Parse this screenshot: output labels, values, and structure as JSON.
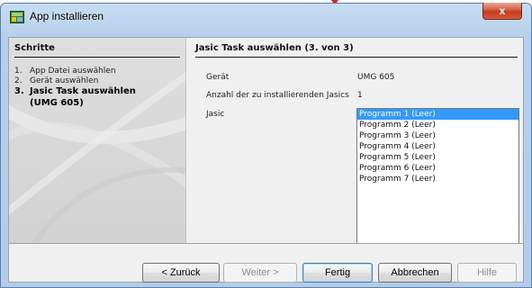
{
  "window": {
    "title": "App installieren",
    "close_label": "x"
  },
  "steps": {
    "title": "Schritte",
    "items": [
      {
        "num": "1.",
        "label": "App Datei auswählen"
      },
      {
        "num": "2.",
        "label": "Gerät auswählen"
      },
      {
        "num": "3.",
        "label": "Jasic Task auswählen",
        "label_cont": "(UMG 605)"
      }
    ],
    "active_index": 2
  },
  "main": {
    "section_title": "Jasic Task auswählen (3. von 3)",
    "fields": [
      {
        "label": "Gerät",
        "value": "UMG 605"
      },
      {
        "label": "Anzahl der zu installierenden Jasics",
        "value": "1"
      },
      {
        "label": "Jasic",
        "value": ""
      }
    ],
    "jasic_list": [
      "Programm 1 (Leer)",
      "Programm 2 (Leer)",
      "Programm 3 (Leer)",
      "Programm 4 (Leer)",
      "Programm 5 (Leer)",
      "Programm 6 (Leer)",
      "Programm 7 (Leer)"
    ],
    "selected_index": 0
  },
  "buttons": {
    "back": "< Zurück",
    "next": "Weiter >",
    "finish": "Fertig",
    "cancel": "Abbrechen",
    "help": "Hilfe"
  },
  "colors": {
    "selection": "#3399ff",
    "close_button": "#c7391d",
    "title_bar": "#b9d1ea"
  },
  "icons": {
    "app_icon": "app-installer-icon",
    "close": "close-icon",
    "pointer": "red-arrow-marker"
  }
}
